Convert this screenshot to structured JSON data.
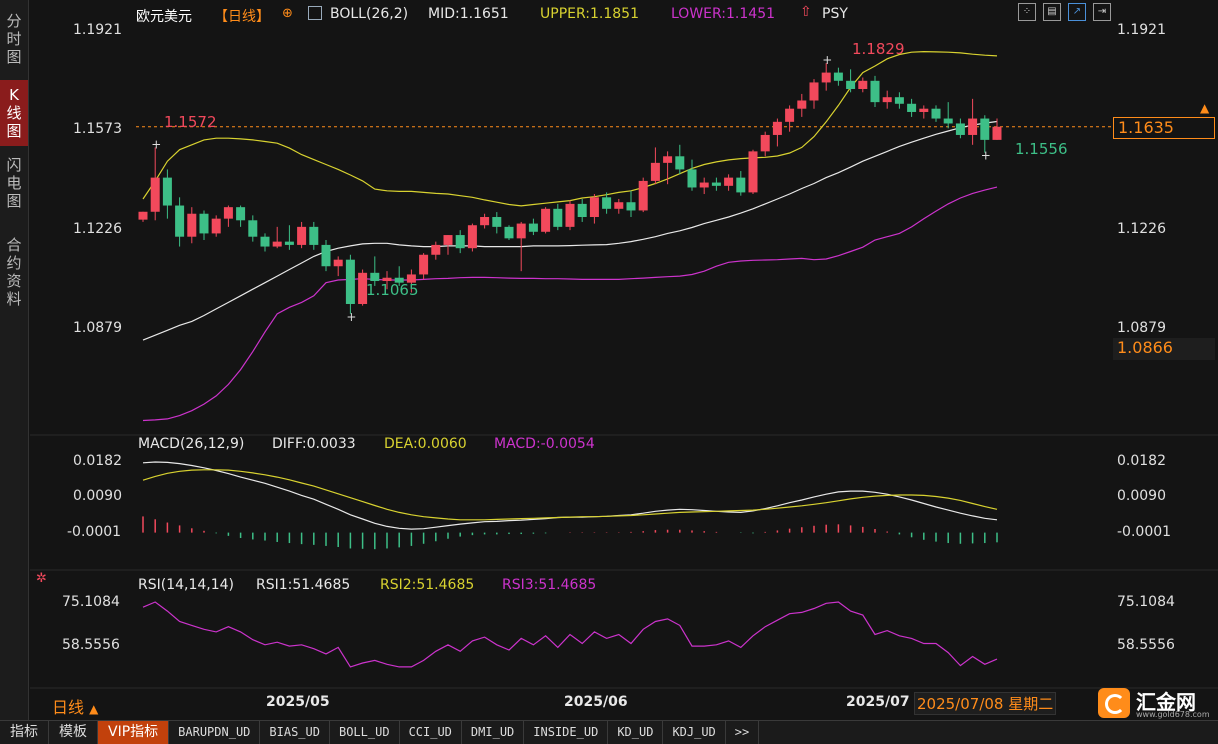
{
  "sidebar": {
    "tabs": [
      {
        "label": "分\n时\n图",
        "active": false
      },
      {
        "label": "K\n线\n图",
        "active": true
      },
      {
        "label": "闪\n电\n图",
        "active": false
      },
      {
        "label": "合\n约\n资\n料",
        "active": false
      }
    ]
  },
  "header": {
    "symbol": "欧元美元",
    "period": "【日线】",
    "indicator": "BOLL(26,2)",
    "mid": "MID:1.1651",
    "upper": "UPPER:1.1851",
    "lower": "LOWER:1.1451",
    "psy": "PSY"
  },
  "toolbar_icons": [
    "grid-icon",
    "window-icon",
    "chart-mode-icon",
    "exit-icon"
  ],
  "colors": {
    "up": "#f2495c",
    "down": "#3dbf87",
    "mid": "#e8e8e8",
    "upper": "#d8d230",
    "lower": "#cc33cc",
    "accent": "#ff8c1a"
  },
  "price_axis": {
    "ticks": [
      "1.1921",
      "1.1573",
      "1.1226",
      "1.0879"
    ]
  },
  "price_boxes": {
    "last": "1.1635",
    "low": "1.0866"
  },
  "annotations": {
    "high1": "1.1572",
    "low1": "1.1065",
    "high2": "1.1829",
    "low2": "1.1556"
  },
  "macd": {
    "title": "MACD(26,12,9)",
    "diff": "DIFF:0.0033",
    "dea": "DEA:0.0060",
    "macd": "MACD:-0.0054",
    "ticks": [
      "0.0182",
      "0.0090",
      "-0.0001"
    ]
  },
  "rsi": {
    "title": "RSI(14,14,14)",
    "rsi1": "RSI1:51.4685",
    "rsi2": "RSI2:51.4685",
    "rsi3": "RSI3:51.4685",
    "ticks": [
      "75.1084",
      "58.5556"
    ]
  },
  "x_axis": {
    "labels": [
      "2025/05",
      "2025/06",
      "2025/07"
    ],
    "current_date": "2025/07/08 星期二"
  },
  "period_selector": "日线",
  "logo": {
    "name": "汇金网",
    "url": "www.gold678.com"
  },
  "bottom_tabs": [
    "指标",
    "模板",
    "VIP指标",
    "BARUPDN_UD",
    "BIAS_UD",
    "BOLL_UD",
    "CCI_UD",
    "DMI_UD",
    "INSIDE_UD",
    "KD_UD",
    "KDJ_UD"
  ],
  "bottom_more": ">>",
  "chart_data": {
    "type": "candlestick",
    "y_range": [
      1.0705,
      1.1945
    ],
    "candles": [
      {
        "o": 1.1352,
        "h": 1.1376,
        "l": 1.1345,
        "c": 1.1376
      },
      {
        "o": 1.1376,
        "h": 1.1572,
        "l": 1.135,
        "c": 1.148
      },
      {
        "o": 1.148,
        "h": 1.1505,
        "l": 1.1355,
        "c": 1.1395
      },
      {
        "o": 1.1395,
        "h": 1.142,
        "l": 1.127,
        "c": 1.13
      },
      {
        "o": 1.13,
        "h": 1.139,
        "l": 1.128,
        "c": 1.137
      },
      {
        "o": 1.137,
        "h": 1.138,
        "l": 1.129,
        "c": 1.131
      },
      {
        "o": 1.131,
        "h": 1.1365,
        "l": 1.13,
        "c": 1.1355
      },
      {
        "o": 1.1355,
        "h": 1.1395,
        "l": 1.133,
        "c": 1.139
      },
      {
        "o": 1.139,
        "h": 1.1395,
        "l": 1.133,
        "c": 1.135
      },
      {
        "o": 1.135,
        "h": 1.1365,
        "l": 1.1285,
        "c": 1.13
      },
      {
        "o": 1.13,
        "h": 1.131,
        "l": 1.1255,
        "c": 1.127
      },
      {
        "o": 1.127,
        "h": 1.133,
        "l": 1.1265,
        "c": 1.1285
      },
      {
        "o": 1.1285,
        "h": 1.1335,
        "l": 1.126,
        "c": 1.1275
      },
      {
        "o": 1.1275,
        "h": 1.1345,
        "l": 1.1265,
        "c": 1.133
      },
      {
        "o": 1.133,
        "h": 1.1345,
        "l": 1.126,
        "c": 1.1275
      },
      {
        "o": 1.1275,
        "h": 1.129,
        "l": 1.1195,
        "c": 1.121
      },
      {
        "o": 1.121,
        "h": 1.124,
        "l": 1.118,
        "c": 1.123
      },
      {
        "o": 1.123,
        "h": 1.1245,
        "l": 1.1065,
        "c": 1.1095
      },
      {
        "o": 1.1095,
        "h": 1.12,
        "l": 1.109,
        "c": 1.119
      },
      {
        "o": 1.119,
        "h": 1.124,
        "l": 1.115,
        "c": 1.1165
      },
      {
        "o": 1.1165,
        "h": 1.1195,
        "l": 1.114,
        "c": 1.1175
      },
      {
        "o": 1.1175,
        "h": 1.121,
        "l": 1.115,
        "c": 1.116
      },
      {
        "o": 1.116,
        "h": 1.12,
        "l": 1.113,
        "c": 1.1185
      },
      {
        "o": 1.1185,
        "h": 1.125,
        "l": 1.117,
        "c": 1.1245
      },
      {
        "o": 1.1245,
        "h": 1.1285,
        "l": 1.123,
        "c": 1.1275
      },
      {
        "o": 1.1275,
        "h": 1.1305,
        "l": 1.1245,
        "c": 1.1305
      },
      {
        "o": 1.1305,
        "h": 1.132,
        "l": 1.125,
        "c": 1.1265
      },
      {
        "o": 1.1265,
        "h": 1.134,
        "l": 1.1255,
        "c": 1.1335
      },
      {
        "o": 1.1335,
        "h": 1.137,
        "l": 1.1325,
        "c": 1.136
      },
      {
        "o": 1.136,
        "h": 1.1375,
        "l": 1.131,
        "c": 1.133
      },
      {
        "o": 1.133,
        "h": 1.1335,
        "l": 1.129,
        "c": 1.1295
      },
      {
        "o": 1.1295,
        "h": 1.1345,
        "l": 1.1195,
        "c": 1.134
      },
      {
        "o": 1.134,
        "h": 1.1355,
        "l": 1.1305,
        "c": 1.1315
      },
      {
        "o": 1.1315,
        "h": 1.139,
        "l": 1.131,
        "c": 1.1385
      },
      {
        "o": 1.1385,
        "h": 1.14,
        "l": 1.132,
        "c": 1.133
      },
      {
        "o": 1.133,
        "h": 1.141,
        "l": 1.132,
        "c": 1.14
      },
      {
        "o": 1.14,
        "h": 1.1415,
        "l": 1.1345,
        "c": 1.136
      },
      {
        "o": 1.136,
        "h": 1.143,
        "l": 1.134,
        "c": 1.142
      },
      {
        "o": 1.142,
        "h": 1.1435,
        "l": 1.137,
        "c": 1.1385
      },
      {
        "o": 1.1385,
        "h": 1.1415,
        "l": 1.137,
        "c": 1.1405
      },
      {
        "o": 1.1405,
        "h": 1.144,
        "l": 1.136,
        "c": 1.138
      },
      {
        "o": 1.138,
        "h": 1.148,
        "l": 1.1375,
        "c": 1.147
      },
      {
        "o": 1.147,
        "h": 1.1572,
        "l": 1.146,
        "c": 1.1525
      },
      {
        "o": 1.1525,
        "h": 1.156,
        "l": 1.146,
        "c": 1.1545
      },
      {
        "o": 1.1545,
        "h": 1.158,
        "l": 1.149,
        "c": 1.1505
      },
      {
        "o": 1.1505,
        "h": 1.1535,
        "l": 1.144,
        "c": 1.145
      },
      {
        "o": 1.145,
        "h": 1.148,
        "l": 1.143,
        "c": 1.1465
      },
      {
        "o": 1.1465,
        "h": 1.148,
        "l": 1.144,
        "c": 1.1455
      },
      {
        "o": 1.1455,
        "h": 1.149,
        "l": 1.144,
        "c": 1.148
      },
      {
        "o": 1.148,
        "h": 1.15,
        "l": 1.1425,
        "c": 1.1435
      },
      {
        "o": 1.1435,
        "h": 1.1565,
        "l": 1.143,
        "c": 1.156
      },
      {
        "o": 1.156,
        "h": 1.162,
        "l": 1.1545,
        "c": 1.161
      },
      {
        "o": 1.161,
        "h": 1.166,
        "l": 1.1575,
        "c": 1.165
      },
      {
        "o": 1.165,
        "h": 1.17,
        "l": 1.162,
        "c": 1.169
      },
      {
        "o": 1.169,
        "h": 1.1735,
        "l": 1.1665,
        "c": 1.1715
      },
      {
        "o": 1.1715,
        "h": 1.178,
        "l": 1.169,
        "c": 1.177
      },
      {
        "o": 1.177,
        "h": 1.1829,
        "l": 1.1745,
        "c": 1.18
      },
      {
        "o": 1.18,
        "h": 1.1815,
        "l": 1.176,
        "c": 1.1775
      },
      {
        "o": 1.1775,
        "h": 1.181,
        "l": 1.174,
        "c": 1.175
      },
      {
        "o": 1.175,
        "h": 1.1785,
        "l": 1.174,
        "c": 1.1775
      },
      {
        "o": 1.1775,
        "h": 1.179,
        "l": 1.1695,
        "c": 1.171
      },
      {
        "o": 1.171,
        "h": 1.1745,
        "l": 1.169,
        "c": 1.1725
      },
      {
        "o": 1.1725,
        "h": 1.174,
        "l": 1.169,
        "c": 1.1705
      },
      {
        "o": 1.1705,
        "h": 1.172,
        "l": 1.1665,
        "c": 1.168
      },
      {
        "o": 1.168,
        "h": 1.17,
        "l": 1.166,
        "c": 1.169
      },
      {
        "o": 1.169,
        "h": 1.17,
        "l": 1.165,
        "c": 1.166
      },
      {
        "o": 1.166,
        "h": 1.171,
        "l": 1.163,
        "c": 1.1645
      },
      {
        "o": 1.1645,
        "h": 1.166,
        "l": 1.16,
        "c": 1.161
      },
      {
        "o": 1.161,
        "h": 1.172,
        "l": 1.158,
        "c": 1.166
      },
      {
        "o": 1.166,
        "h": 1.167,
        "l": 1.1556,
        "c": 1.1595
      },
      {
        "o": 1.1595,
        "h": 1.166,
        "l": 1.1595,
        "c": 1.1635
      }
    ],
    "boll_mid": [
      1.0985,
      1.1,
      1.1015,
      1.103,
      1.1042,
      1.106,
      1.108,
      1.11,
      1.112,
      1.114,
      1.116,
      1.118,
      1.12,
      1.122,
      1.124,
      1.1255,
      1.1265,
      1.1272,
      1.1278,
      1.128,
      1.128,
      1.1275,
      1.1272,
      1.127,
      1.127,
      1.1272,
      1.1272,
      1.1272,
      1.127,
      1.127,
      1.127,
      1.127,
      1.1272,
      1.1272,
      1.1272,
      1.1273,
      1.1274,
      1.1275,
      1.1276,
      1.128,
      1.1285,
      1.1292,
      1.13,
      1.131,
      1.1318,
      1.1328,
      1.134,
      1.135,
      1.136,
      1.1372,
      1.1385,
      1.14,
      1.1415,
      1.143,
      1.1447,
      1.1462,
      1.148,
      1.1495,
      1.1512,
      1.153,
      1.1545,
      1.156,
      1.1575,
      1.1588,
      1.16,
      1.1612,
      1.1622,
      1.1632,
      1.164,
      1.1646,
      1.1651
    ],
    "boll_upper": [
      1.1415,
      1.147,
      1.153,
      1.1565,
      1.158,
      1.1595,
      1.16,
      1.16,
      1.1598,
      1.1595,
      1.159,
      1.1585,
      1.157,
      1.155,
      1.1535,
      1.152,
      1.1505,
      1.1488,
      1.147,
      1.1445,
      1.144,
      1.1438,
      1.1438,
      1.1435,
      1.1432,
      1.143,
      1.1425,
      1.142,
      1.1412,
      1.1405,
      1.1398,
      1.1394,
      1.1398,
      1.1402,
      1.1406,
      1.141,
      1.1418,
      1.1422,
      1.1428,
      1.1435,
      1.144,
      1.145,
      1.1462,
      1.1476,
      1.1492,
      1.1508,
      1.152,
      1.1528,
      1.1534,
      1.1538,
      1.154,
      1.1542,
      1.1546,
      1.1555,
      1.1572,
      1.1605,
      1.165,
      1.17,
      1.1755,
      1.18,
      1.182,
      1.1842,
      1.1855,
      1.1862,
      1.1864,
      1.1863,
      1.1862,
      1.186,
      1.1856,
      1.1853,
      1.1851
    ],
    "boll_lower": [
      1.074,
      1.0742,
      1.0745,
      1.0755,
      1.077,
      1.079,
      1.0815,
      1.085,
      1.0895,
      1.095,
      1.101,
      1.1065,
      1.1085,
      1.11,
      1.112,
      1.116,
      1.1168,
      1.117,
      1.1172,
      1.117,
      1.1168,
      1.1168,
      1.1168,
      1.117,
      1.1172,
      1.1173,
      1.1175,
      1.1176,
      1.1176,
      1.1175,
      1.1174,
      1.1173,
      1.1173,
      1.1172,
      1.1172,
      1.1171,
      1.117,
      1.117,
      1.117,
      1.117,
      1.1172,
      1.1174,
      1.1176,
      1.1178,
      1.118,
      1.1185,
      1.1195,
      1.121,
      1.1222,
      1.1226,
      1.1228,
      1.1229,
      1.123,
      1.1232,
      1.1234,
      1.123,
      1.1232,
      1.1242,
      1.1255,
      1.1268,
      1.129,
      1.13,
      1.131,
      1.133,
      1.1355,
      1.1378,
      1.14,
      1.1418,
      1.1432,
      1.1442,
      1.1451
    ],
    "macd_diff": [
      0.018,
      0.0182,
      0.0181,
      0.0178,
      0.0173,
      0.0167,
      0.016,
      0.0152,
      0.0143,
      0.0135,
      0.0127,
      0.0117,
      0.0107,
      0.0096,
      0.0086,
      0.0073,
      0.006,
      0.0046,
      0.0035,
      0.0024,
      0.0016,
      0.0011,
      0.0009,
      0.001,
      0.0014,
      0.0018,
      0.0022,
      0.0025,
      0.0028,
      0.0029,
      0.0031,
      0.0032,
      0.0034,
      0.0036,
      0.0039,
      0.004,
      0.004,
      0.0041,
      0.0042,
      0.0044,
      0.0046,
      0.005,
      0.0055,
      0.0058,
      0.006,
      0.0059,
      0.0057,
      0.0055,
      0.0053,
      0.0052,
      0.0056,
      0.0062,
      0.0069,
      0.0077,
      0.0084,
      0.0092,
      0.0099,
      0.0105,
      0.0107,
      0.0107,
      0.0104,
      0.0099,
      0.0092,
      0.0084,
      0.0075,
      0.0066,
      0.0058,
      0.005,
      0.0043,
      0.0037,
      0.0033
    ],
    "macd_dea": [
      0.0135,
      0.0145,
      0.0153,
      0.0158,
      0.0161,
      0.0162,
      0.0162,
      0.0161,
      0.0158,
      0.0154,
      0.0149,
      0.0143,
      0.0136,
      0.0128,
      0.012,
      0.011,
      0.01,
      0.009,
      0.008,
      0.007,
      0.006,
      0.0052,
      0.0046,
      0.0041,
      0.0038,
      0.0035,
      0.0033,
      0.0033,
      0.0033,
      0.0034,
      0.0035,
      0.0036,
      0.0037,
      0.0038,
      0.0039,
      0.004,
      0.0041,
      0.0041,
      0.0042,
      0.0043,
      0.0044,
      0.0046,
      0.0048,
      0.005,
      0.0052,
      0.0053,
      0.0054,
      0.0055,
      0.0056,
      0.0057,
      0.0058,
      0.006,
      0.0063,
      0.0066,
      0.0069,
      0.0073,
      0.0077,
      0.0082,
      0.0087,
      0.0091,
      0.0094,
      0.0096,
      0.0097,
      0.0097,
      0.0096,
      0.0093,
      0.0089,
      0.0083,
      0.0075,
      0.0067,
      0.006
    ],
    "macd_hist": [
      0.009,
      0.0074,
      0.0056,
      0.004,
      0.0024,
      0.001,
      -0.0004,
      -0.0018,
      -0.003,
      -0.0038,
      -0.0044,
      -0.0052,
      -0.0058,
      -0.0064,
      -0.0068,
      -0.0074,
      -0.008,
      -0.0088,
      -0.009,
      -0.0092,
      -0.0088,
      -0.0082,
      -0.0074,
      -0.0062,
      -0.0048,
      -0.0034,
      -0.0022,
      -0.0014,
      -0.001,
      -0.001,
      -0.0008,
      -0.0008,
      -0.0006,
      -0.0004,
      0.0,
      0.0002,
      0.0002,
      0.0002,
      0.0002,
      0.0002,
      0.0004,
      0.0008,
      0.0014,
      0.0016,
      0.0016,
      0.0012,
      0.0008,
      0.0004,
      0.0,
      -0.0002,
      -0.0004,
      0.0004,
      0.0012,
      0.0022,
      0.003,
      0.0038,
      0.0044,
      0.0046,
      0.004,
      0.0032,
      0.002,
      0.0006,
      -0.001,
      -0.0026,
      -0.004,
      -0.005,
      -0.0058,
      -0.0062,
      -0.006,
      -0.0058,
      -0.0054
    ],
    "rsi1": [
      73.5,
      75.5,
      72.0,
      68.0,
      66.5,
      65.0,
      64.0,
      66.0,
      64.0,
      61.0,
      59.0,
      60.0,
      58.5,
      59.0,
      57.5,
      55.5,
      58.0,
      50.5,
      52.0,
      53.0,
      51.5,
      50.5,
      50.5,
      53.0,
      56.5,
      59.0,
      56.5,
      60.5,
      62.0,
      59.0,
      57.0,
      61.5,
      59.0,
      62.5,
      58.0,
      63.0,
      59.5,
      64.0,
      61.5,
      63.0,
      59.5,
      65.0,
      68.0,
      69.0,
      66.5,
      58.5,
      58.5,
      59.0,
      60.5,
      58.0,
      62.5,
      66.0,
      68.5,
      71.0,
      71.5,
      73.0,
      75.0,
      75.5,
      72.0,
      70.5,
      63.0,
      64.5,
      62.5,
      61.5,
      59.5,
      59.5,
      56.0,
      51.0,
      54.5,
      51.5,
      53.5
    ]
  }
}
